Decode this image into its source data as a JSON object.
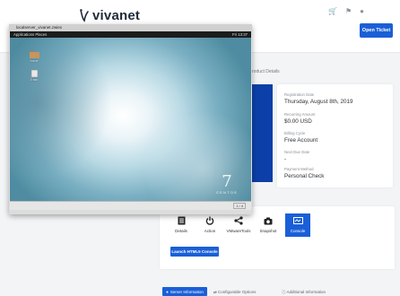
{
  "header": {
    "brand": "vivanet",
    "open_ticket_label": "Open Ticket",
    "icons": [
      "cart-icon",
      "bell-icon",
      "user-icon"
    ]
  },
  "product": {
    "breadcrumb": "roduct Details",
    "fields": [
      {
        "label": "Registration Date",
        "value": "Thursday, August 8th, 2019"
      },
      {
        "label": "Recurring Amount",
        "value": "$0.00 USD"
      },
      {
        "label": "Billing Cycle",
        "value": "Free Account"
      },
      {
        "label": "Next Due Date",
        "value": "-"
      },
      {
        "label": "Payment Method",
        "value": "Personal Check"
      }
    ]
  },
  "actions": [
    {
      "label": "Details",
      "icon": "details-icon"
    },
    {
      "label": "Action",
      "icon": "power-icon"
    },
    {
      "label": "VMwareTools",
      "icon": "share-icon"
    },
    {
      "label": "Snapshot",
      "icon": "camera-icon"
    },
    {
      "label": "Console",
      "icon": "console-icon",
      "active": true
    }
  ],
  "launch_label": "Launch HTML5 Console",
  "tabs": {
    "active": "Server Information",
    "others": [
      "Configurable Options",
      "Additional Information"
    ]
  },
  "console": {
    "window_title": "localserver_vivanet.zwiex",
    "menu_left": "Applications   Places",
    "menu_right": "Fri 13:37",
    "desktop_icons": [
      "home",
      "Trash"
    ],
    "os_number": "7",
    "os_word": "CENTOS",
    "pager": "1 / 4"
  },
  "colors": {
    "accent": "#1a5fd7",
    "card_strip": "#0d3fa8"
  }
}
